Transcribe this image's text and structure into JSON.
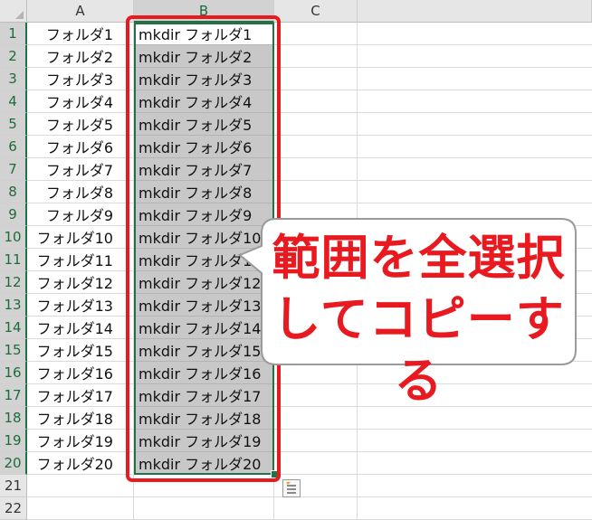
{
  "columns": [
    "A",
    "B",
    "C"
  ],
  "rows": [
    {
      "num": "1",
      "a": "フォルダ1",
      "b": "mkdir フォルダ1"
    },
    {
      "num": "2",
      "a": "フォルダ2",
      "b": "mkdir フォルダ2"
    },
    {
      "num": "3",
      "a": "フォルダ3",
      "b": "mkdir フォルダ3"
    },
    {
      "num": "4",
      "a": "フォルダ4",
      "b": "mkdir フォルダ4"
    },
    {
      "num": "5",
      "a": "フォルダ5",
      "b": "mkdir フォルダ5"
    },
    {
      "num": "6",
      "a": "フォルダ6",
      "b": "mkdir フォルダ6"
    },
    {
      "num": "7",
      "a": "フォルダ7",
      "b": "mkdir フォルダ7"
    },
    {
      "num": "8",
      "a": "フォルダ8",
      "b": "mkdir フォルダ8"
    },
    {
      "num": "9",
      "a": "フォルダ9",
      "b": "mkdir フォルダ9"
    },
    {
      "num": "10",
      "a": "フォルダ10",
      "b": "mkdir フォルダ10"
    },
    {
      "num": "11",
      "a": "フォルダ11",
      "b": "mkdir フォルダ11"
    },
    {
      "num": "12",
      "a": "フォルダ12",
      "b": "mkdir フォルダ12"
    },
    {
      "num": "13",
      "a": "フォルダ13",
      "b": "mkdir フォルダ13"
    },
    {
      "num": "14",
      "a": "フォルダ14",
      "b": "mkdir フォルダ14"
    },
    {
      "num": "15",
      "a": "フォルダ15",
      "b": "mkdir フォルダ15"
    },
    {
      "num": "16",
      "a": "フォルダ16",
      "b": "mkdir フォルダ16"
    },
    {
      "num": "17",
      "a": "フォルダ17",
      "b": "mkdir フォルダ17"
    },
    {
      "num": "18",
      "a": "フォルダ18",
      "b": "mkdir フォルダ18"
    },
    {
      "num": "19",
      "a": "フォルダ19",
      "b": "mkdir フォルダ19"
    },
    {
      "num": "20",
      "a": "フォルダ20",
      "b": "mkdir フォルダ20"
    },
    {
      "num": "21",
      "a": "",
      "b": ""
    },
    {
      "num": "22",
      "a": "",
      "b": ""
    }
  ],
  "selected_column": "B",
  "active_cell": "B1",
  "callout": {
    "line1": "範囲を全選択",
    "line2": "してコピーする"
  },
  "quick_analysis_icon": "quick-analysis-icon",
  "colors": {
    "accent": "#217346",
    "highlight": "#e8191f",
    "selection_fill": "#c8c8c8"
  }
}
